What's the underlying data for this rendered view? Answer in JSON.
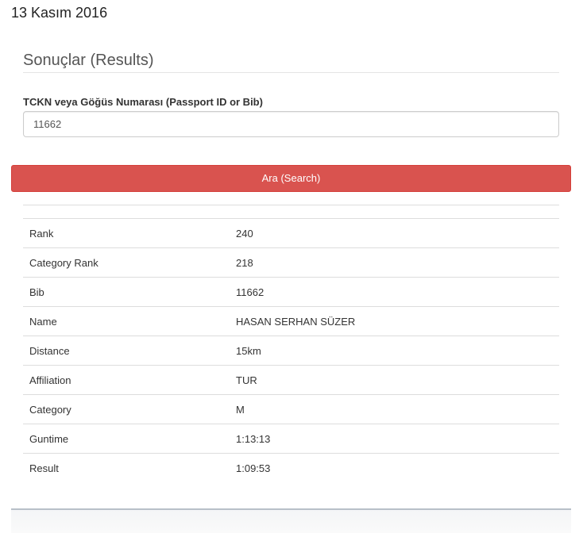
{
  "header": {
    "date": "13 Kasım 2016"
  },
  "results_section": {
    "title": "Sonuçlar (Results)"
  },
  "search": {
    "label": "TCKN veya Göğüs Numarası (Passport ID or Bib)",
    "value": "11662",
    "placeholder": "",
    "button_label": "Ara (Search)"
  },
  "result_rows": [
    {
      "label": "Rank",
      "value": "240"
    },
    {
      "label": "Category Rank",
      "value": "218"
    },
    {
      "label": "Bib",
      "value": "11662"
    },
    {
      "label": "Name",
      "value": "HASAN SERHAN SÜZER"
    },
    {
      "label": "Distance",
      "value": "15km"
    },
    {
      "label": "Affiliation",
      "value": "TUR"
    },
    {
      "label": "Category",
      "value": "M"
    },
    {
      "label": "Guntime",
      "value": "1:13:13"
    },
    {
      "label": "Result",
      "value": "1:09:53"
    }
  ],
  "colors": {
    "search_button": "#d9534f",
    "row_border": "#dddddd"
  }
}
